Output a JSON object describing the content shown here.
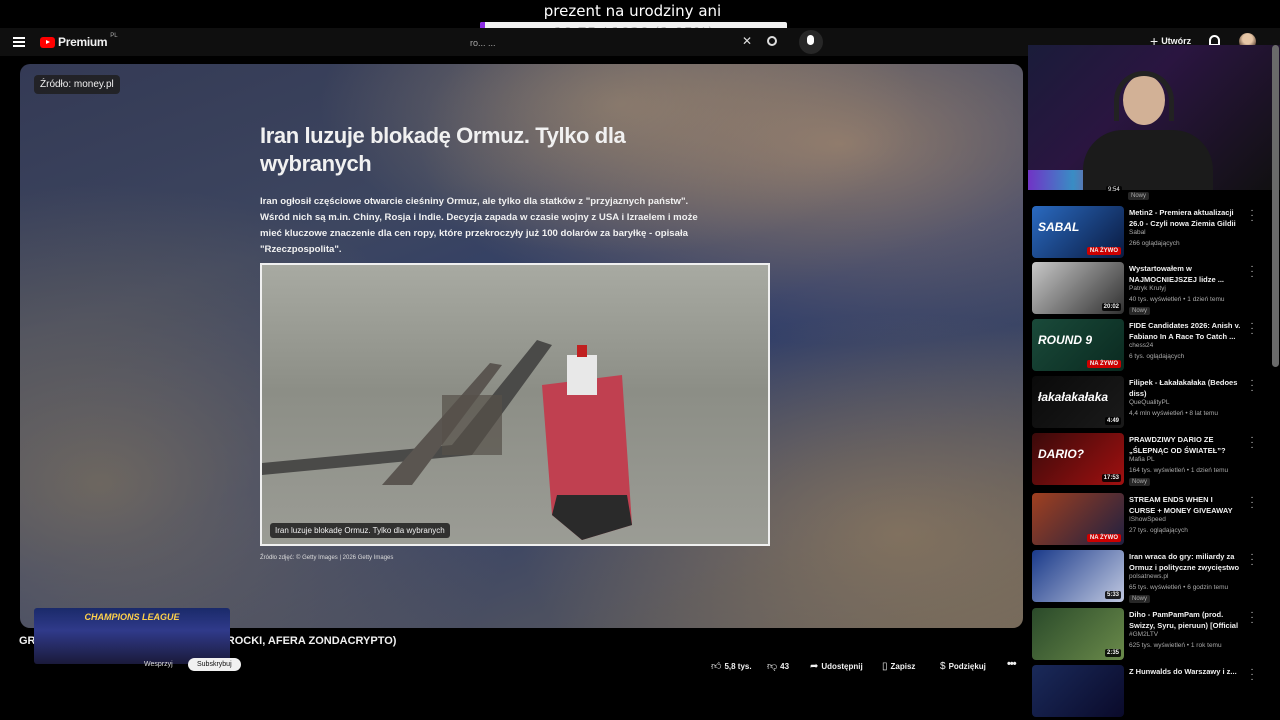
{
  "stream_overlay": {
    "title": "prezent na urodziny ani",
    "goal_text": "10.75 / 1020 (1.05%)",
    "goal_fraction": 0.0105,
    "goal_fill_color": "#8a2be2"
  },
  "header": {
    "logo_text": "Premium",
    "logo_region": "PL",
    "search_text": "ro... ...",
    "create_label": "Utwórz",
    "icons": [
      "menu-icon",
      "youtube-logo-icon",
      "close-icon",
      "search-icon",
      "mic-icon",
      "plus-icon",
      "bell-icon",
      "avatar"
    ]
  },
  "player": {
    "source_badge": "Źródło: money.pl",
    "news_title": "Iran luzuje blokadę Ormuz. Tylko dla wybranych",
    "news_body": "Iran ogłosił częściowe otwarcie cieśniny Ormuz, ale tylko dla statków z \"przyjaznych państw\". Wśród nich są m.in. Chiny, Rosja i Indie. Decyzja zapada w czasie wojny z USA i Izraelem i może mieć kluczowe znaczenie dla cen ropy, które przekroczyły już 100 dolarów za baryłkę - opisała \"Rzeczpospolita\".",
    "image_caption": "Iran luzuje blokadę Ormuz. Tylko dla wybranych",
    "image_credits": "Źródło zdjęć: © Getty Images | 2026 Getty Images"
  },
  "video": {
    "title": "GR... ...EM (KSIĄŻULO, GESSLER, NAWROCKI, AFERA ZONDACRYPTO)",
    "champions_overlay": "CHAMPIONS LEAGUE",
    "support_label": "Wesprzyj",
    "subscribe_label": "Subskrybuj",
    "likes": "5,8 tys.",
    "dislikes": "43",
    "share_label": "Udostępnij",
    "save_label": "Zapisz",
    "thanks_label": "Podziękuj",
    "more_label": "•••"
  },
  "sidebar": {
    "partial_duration": "9:54",
    "partial_badge": "Nowy",
    "items": [
      {
        "title": "Metin2 - Premiera aktualizacji 26.0 - Czyli nowa Ziemia Gildii ...",
        "channel": "Sabal",
        "meta": "266 oglądających",
        "badge": "NA ŻYWO",
        "live": true,
        "nowy": "",
        "thumb_a": "#2a6ac0",
        "thumb_b": "#0a1a40",
        "thumb_text": "SABAL"
      },
      {
        "title": "Wystartowałem w NAJMOCNIEJSZEJ lidze ...",
        "channel": "Patryk Krutyj",
        "meta": "40 tys. wyświetleń • 1 dzień temu",
        "badge": "20:02",
        "live": false,
        "nowy": "Nowy",
        "thumb_a": "#c8c8c8",
        "thumb_b": "#303030",
        "thumb_text": ""
      },
      {
        "title": "FIDE Candidates 2026: Anish v. Fabiano In A Race To Catch ...",
        "channel": "chess24",
        "meta": "6 tys. oglądających",
        "badge": "NA ŻYWO",
        "live": true,
        "nowy": "",
        "thumb_a": "#1a4a3a",
        "thumb_b": "#0a2a20",
        "thumb_text": "ROUND 9"
      },
      {
        "title": "Filipek - Łakałakałaka (Bedoes diss)",
        "channel": "QueQualityPL",
        "meta": "4,4 mln wyświetleń • 8 lat temu",
        "badge": "4:49",
        "live": false,
        "nowy": "",
        "thumb_a": "#0a0a0a",
        "thumb_b": "#1a1a1a",
        "thumb_text": "łakałakałaka"
      },
      {
        "title": "PRAWDZIWY DARIO ZE „ŚLEPNĄC OD ŚWIATEŁ”? DA...",
        "channel": "Mafia PL",
        "meta": "164 tys. wyświetleń • 1 dzień temu",
        "badge": "17:53",
        "live": false,
        "nowy": "Nowy",
        "thumb_a": "#3a0a0a",
        "thumb_b": "#a01010",
        "thumb_text": "DARIO?"
      },
      {
        "title": "STREAM ENDS WHEN I CURSE + MONEY GIVEAWAY",
        "channel": "IShowSpeed",
        "meta": "27 tys. oglądających",
        "badge": "NA ŻYWO",
        "live": true,
        "nowy": "",
        "thumb_a": "#a04020",
        "thumb_b": "#202040",
        "thumb_text": ""
      },
      {
        "title": "Iran wraca do gry: miliardy za Ormuz i polityczne zwycięstwo",
        "channel": "polsatnews.pl",
        "meta": "65 tys. wyświetleń • 6 godzin temu",
        "badge": "5:33",
        "live": false,
        "nowy": "Nowy",
        "thumb_a": "#1a3a8a",
        "thumb_b": "#c0c8e0",
        "thumb_text": ""
      },
      {
        "title": "Diho - PamPamPam (prod. Swizzy, Syru, pieruun) [Official ...",
        "channel": "#GM2LTV",
        "meta": "625 tys. wyświetleń • 1 rok temu",
        "badge": "2:35",
        "live": false,
        "nowy": "",
        "thumb_a": "#2a4a2a",
        "thumb_b": "#6a8a4a",
        "thumb_text": ""
      },
      {
        "title": "Z Hunwalds do Warszawy i z...",
        "channel": "",
        "meta": "",
        "badge": "",
        "live": false,
        "nowy": "",
        "thumb_a": "#1a2a5a",
        "thumb_b": "#0a0a2a",
        "thumb_text": ""
      }
    ]
  }
}
